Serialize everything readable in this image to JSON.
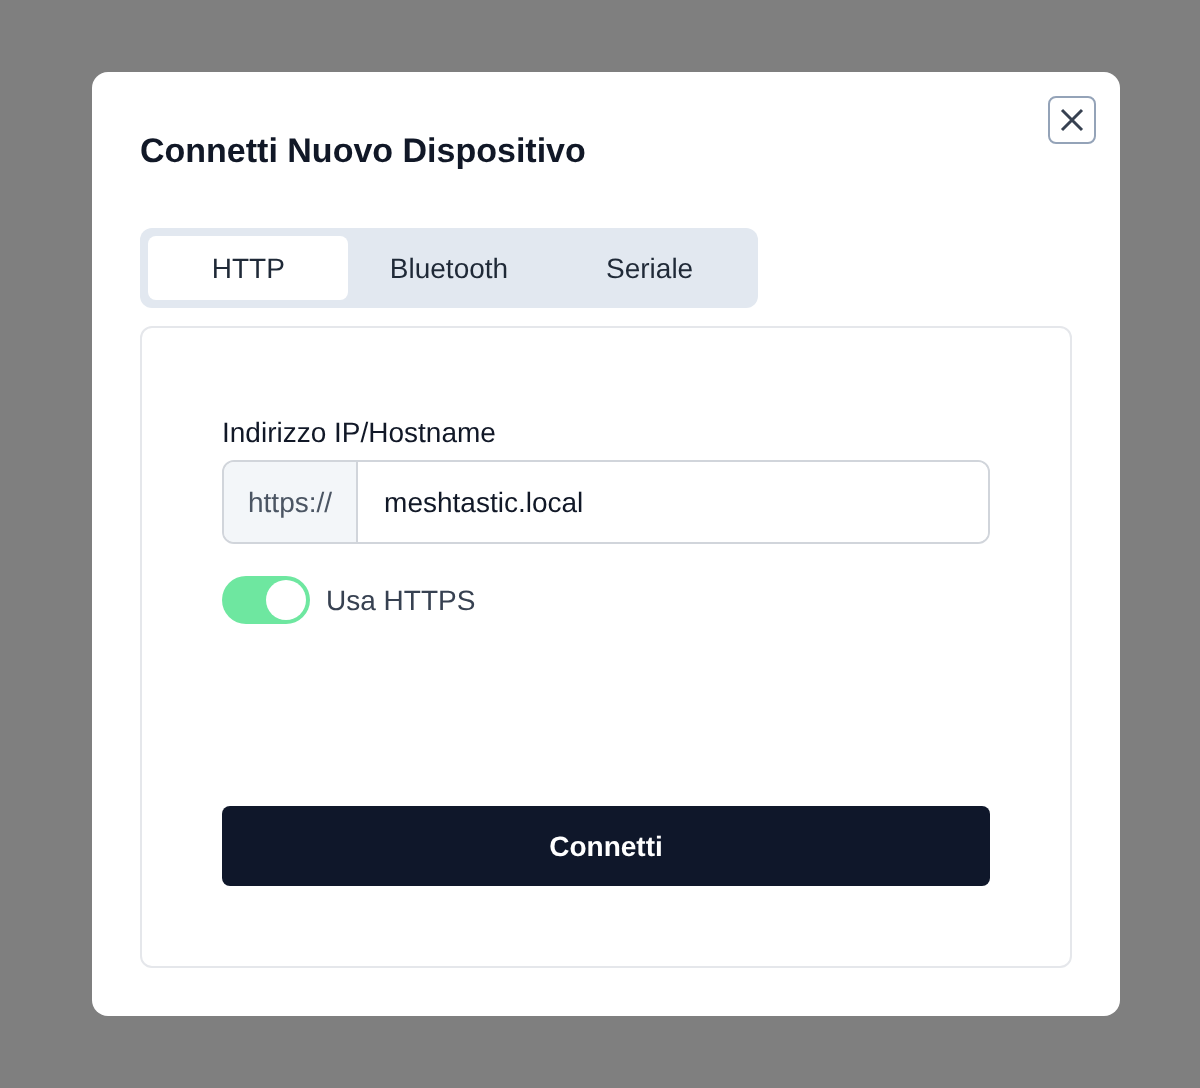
{
  "dialog": {
    "title": "Connetti Nuovo Dispositivo"
  },
  "tabs": [
    {
      "label": "HTTP",
      "selected": true
    },
    {
      "label": "Bluetooth",
      "selected": false
    },
    {
      "label": "Seriale",
      "selected": false
    }
  ],
  "form": {
    "label": "Indirizzo IP/Hostname",
    "prefix": "https://",
    "value": "meshtastic.local",
    "toggle": {
      "label": "Usa HTTPS",
      "on": true
    },
    "button": "Connetti"
  }
}
